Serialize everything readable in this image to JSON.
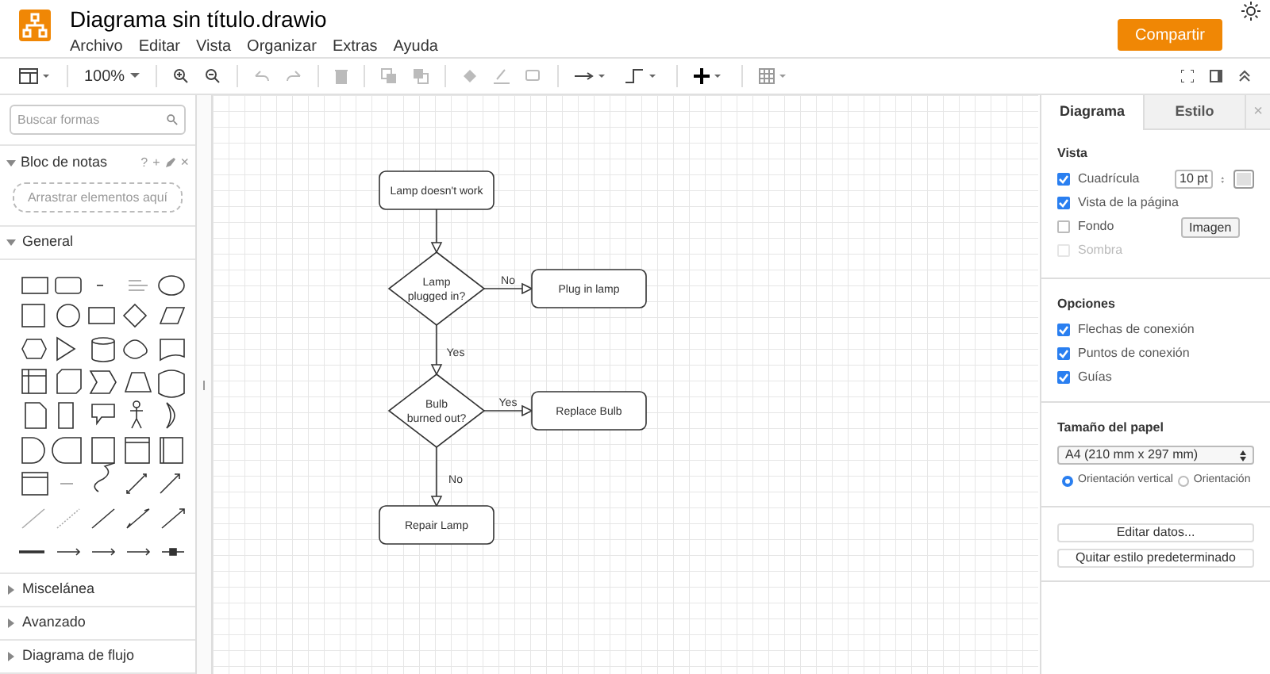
{
  "header": {
    "title": "Diagrama sin título.drawio",
    "menu": [
      "Archivo",
      "Editar",
      "Vista",
      "Organizar",
      "Extras",
      "Ayuda"
    ],
    "share_button": "Compartir"
  },
  "toolbar": {
    "zoom": "100%"
  },
  "sidebar": {
    "search": {
      "placeholder": "Buscar formas"
    },
    "scratchpad": {
      "title": "Bloc de notas",
      "expanded": true,
      "actions": [
        "?",
        "+"
      ],
      "close": "×",
      "drop_hint": "Arrastrar elementos aquí"
    },
    "sections": [
      {
        "title": "General",
        "expanded": true
      },
      {
        "title": "Miscelánea",
        "expanded": false
      },
      {
        "title": "Avanzado",
        "expanded": false
      },
      {
        "title": "Diagrama de flujo",
        "expanded": false
      }
    ]
  },
  "diagram": {
    "nodes": [
      {
        "kind": "process",
        "label": "Lamp doesn't work"
      },
      {
        "kind": "decision",
        "label": "Lamp plugged in?"
      },
      {
        "kind": "process",
        "label": "Plug in lamp"
      },
      {
        "kind": "decision",
        "label": "Bulb burned out?"
      },
      {
        "kind": "process",
        "label": "Replace Bulb"
      },
      {
        "kind": "process",
        "label": "Repair Lamp"
      }
    ],
    "edges": [
      {
        "kind": "arrow"
      },
      {
        "kind": "arrow",
        "label": "No"
      },
      {
        "kind": "arrow",
        "label": "Yes"
      },
      {
        "kind": "arrow",
        "label": "Yes"
      },
      {
        "kind": "arrow",
        "label": "No"
      }
    ]
  },
  "format_panel": {
    "tabs": [
      {
        "label": "Diagrama",
        "selected": true
      },
      {
        "label": "Estilo",
        "selected": false
      }
    ],
    "close": "×",
    "view": {
      "title": "Vista",
      "items": [
        {
          "kind": "grid",
          "label": "Cuadrícula",
          "checked": true,
          "disabled": false,
          "value": "10 pt"
        },
        {
          "kind": "plain",
          "label": "Vista de la página",
          "checked": true,
          "disabled": false
        },
        {
          "kind": "button",
          "label": "Fondo",
          "checked": false,
          "disabled": false,
          "button": "Imagen"
        },
        {
          "kind": "plain",
          "label": "Sombra",
          "checked": false,
          "disabled": true
        }
      ]
    },
    "options": {
      "title": "Opciones",
      "items": [
        {
          "label": "Flechas de conexión",
          "checked": true
        },
        {
          "label": "Puntos de conexión",
          "checked": true
        },
        {
          "label": "Guías",
          "checked": true
        }
      ]
    },
    "paper": {
      "title": "Tamaño del papel",
      "size": "A4 (210 mm x 297 mm)",
      "orientations": [
        {
          "label": "Orientación vertical",
          "selected": true
        },
        {
          "label": "Orientación",
          "selected": false
        }
      ]
    },
    "buttons": [
      "Editar datos...",
      "Quitar estilo predeterminado"
    ]
  }
}
